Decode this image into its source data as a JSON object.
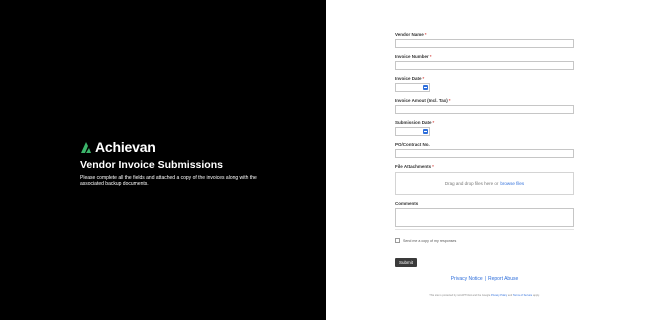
{
  "brand": {
    "name": "Achievan"
  },
  "hero": {
    "title": "Vendor Invoice Submissions",
    "description": "Please complete all the fields and attached a copy of the invoices along with the associated backup documents."
  },
  "form": {
    "vendor_name_label": "Vendor Name",
    "invoice_number_label": "Invoice Number",
    "invoice_date_label": "Invoice Date",
    "invoice_amount_label": "Invoice Amout (Incl. Tax)",
    "submission_date_label": "Submission Date",
    "po_contract_label": "PO/Contract No.",
    "file_attachments_label": "File Attachments",
    "dropzone_text": "Drag and drop files here or",
    "dropzone_link": "browse files",
    "comments_label": "Comments",
    "required_mark": "*",
    "copy_checkbox_label": "Send me a copy of my responses",
    "submit_label": "Submit"
  },
  "footer": {
    "privacy_notice": "Privacy Notice",
    "separator": "|",
    "report_abuse": "Report Abuse",
    "recaptcha_text": "This site is protected by reCAPTCHA and the Google",
    "recaptcha_privacy": "Privacy Policy",
    "recaptcha_and": "and",
    "recaptcha_terms": "Terms of Service",
    "recaptcha_apply": "apply."
  },
  "colors": {
    "left_bg": "#000000",
    "accent": "#2f6fdb",
    "brand_green": "#3bb56a",
    "button": "#3a3a3a",
    "required": "#d9534f"
  }
}
